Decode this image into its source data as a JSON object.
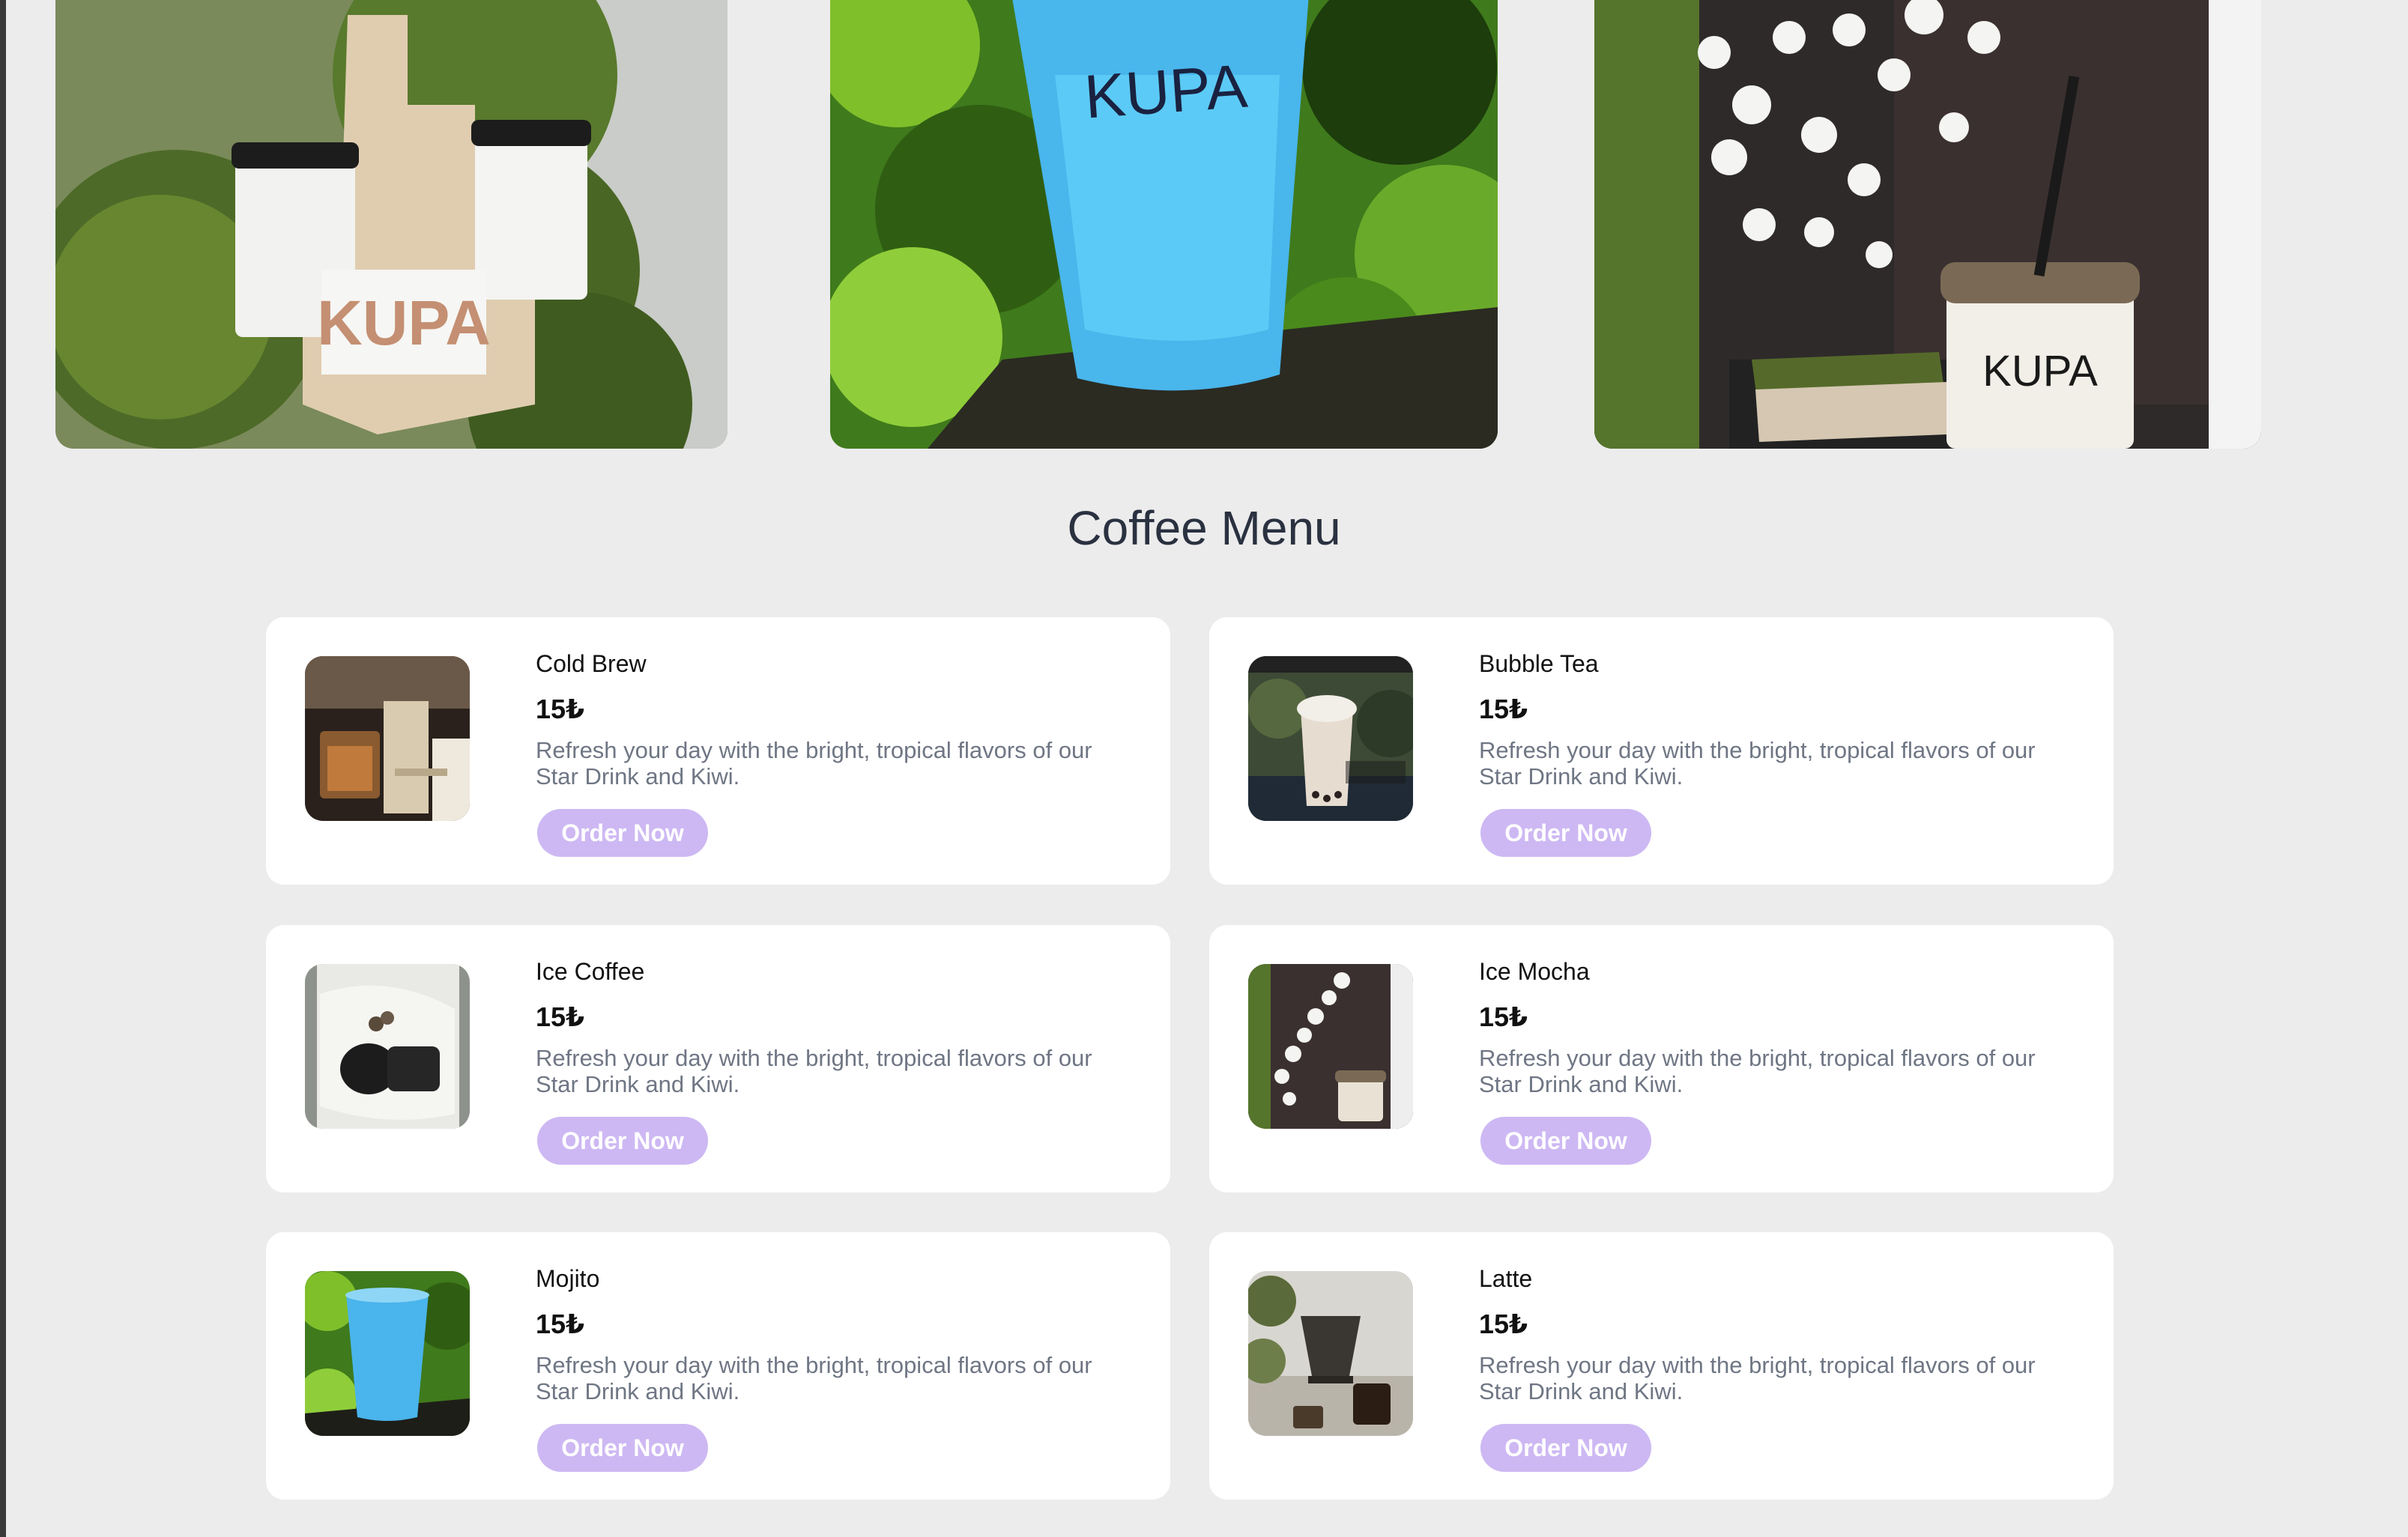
{
  "gallery": {
    "images": [
      {
        "logo_text": "KUPA"
      },
      {
        "logo_text": "KUPA"
      },
      {
        "logo_text": "KUPA"
      }
    ]
  },
  "menu": {
    "title": "Coffee Menu",
    "items": [
      {
        "name": "Cold Brew",
        "price": "15₺",
        "description": "Refresh your day with the bright, tropical flavors of our Star Drink and Kiwi.",
        "button": "Order Now"
      },
      {
        "name": "Bubble Tea",
        "price": "15₺",
        "description": "Refresh your day with the bright, tropical flavors of our Star Drink and Kiwi.",
        "button": "Order Now"
      },
      {
        "name": "Ice Coffee",
        "price": "15₺",
        "description": "Refresh your day with the bright, tropical flavors of our Star Drink and Kiwi.",
        "button": "Order Now"
      },
      {
        "name": "Ice Mocha",
        "price": "15₺",
        "description": "Refresh your day with the bright, tropical flavors of our Star Drink and Kiwi.",
        "button": "Order Now"
      },
      {
        "name": "Mojito",
        "price": "15₺",
        "description": "Refresh your day with the bright, tropical flavors of our Star Drink and Kiwi.",
        "button": "Order Now"
      },
      {
        "name": "Latte",
        "price": "15₺",
        "description": "Refresh your day with the bright, tropical flavors of our Star Drink and Kiwi.",
        "button": "Order Now"
      }
    ]
  },
  "colors": {
    "page_background": "#ececec",
    "card_background": "#ffffff",
    "button_background": "#cdb8f3",
    "title_color": "#2a3140",
    "description_color": "#6f7684"
  }
}
